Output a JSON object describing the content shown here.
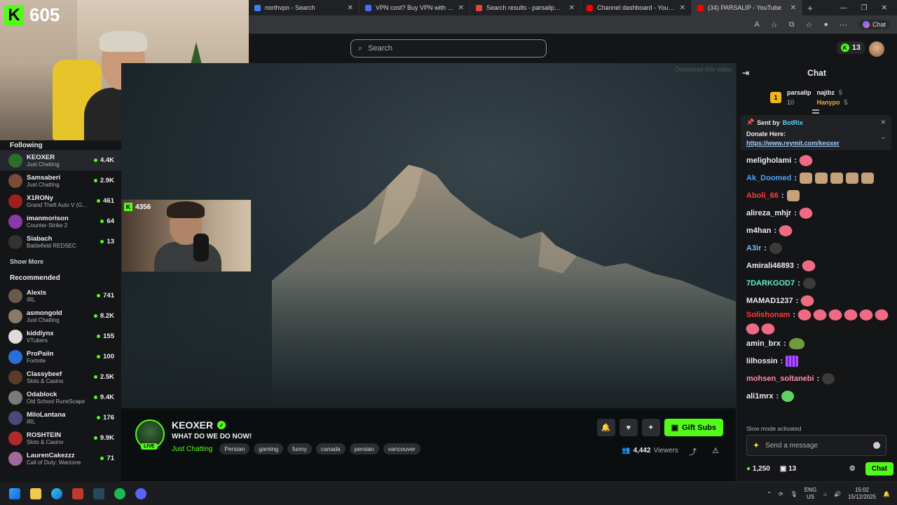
{
  "browser": {
    "tabs": [
      {
        "label": "northvpn - Search",
        "color": "#3b82f6"
      },
      {
        "label": "VPN cost? Buy VPN with Credit C",
        "color": "#4a6cf7"
      },
      {
        "label": "Search results - parsalip@google",
        "color": "#ea4335"
      },
      {
        "label": "Channel dashboard - YouTube St",
        "color": "#ff0000"
      },
      {
        "label": "(34) PARSALIP - YouTube",
        "color": "#ff0000"
      }
    ],
    "copilot_label": "Chat"
  },
  "webcam": {
    "viewer_count": "605",
    "logo_letter": "K"
  },
  "header": {
    "search_placeholder": "Search",
    "coins": "13",
    "download_hint": "Download this video"
  },
  "sidebar": {
    "following_title": "Following",
    "following": [
      {
        "name": "KEOXER",
        "category": "Just Chatting",
        "viewers": "4.4K",
        "color": "#2f6b2f"
      },
      {
        "name": "Samsaberi",
        "category": "Just Chatting",
        "viewers": "2.9K",
        "color": "#7a4a3a"
      },
      {
        "name": "X1RONy",
        "category": "Grand Theft Auto V (G...",
        "viewers": "461",
        "color": "#a02020"
      },
      {
        "name": "imanmorison",
        "category": "Counter-Strike 2",
        "viewers": "64",
        "color": "#8a3aa8"
      },
      {
        "name": "Siabach",
        "category": "Battlefield REDSEC",
        "viewers": "13",
        "color": "#333333"
      }
    ],
    "show_more": "Show More",
    "recommended_title": "Recommended",
    "recommended": [
      {
        "name": "Alexis",
        "category": "IRL",
        "viewers": "741",
        "color": "#6a5a4a"
      },
      {
        "name": "asmongold",
        "category": "Just Chatting",
        "viewers": "8.2K",
        "color": "#8a7a6a"
      },
      {
        "name": "kiddlynx",
        "category": "VTubers",
        "viewers": "155",
        "color": "#dcdcdc"
      },
      {
        "name": "ProPaiin",
        "category": "Fortnite",
        "viewers": "100",
        "color": "#2a6fd6"
      },
      {
        "name": "Classybeef",
        "category": "Slots & Casino",
        "viewers": "2.5K",
        "color": "#5a3a2a"
      },
      {
        "name": "Odablock",
        "category": "Old School RuneScape",
        "viewers": "9.4K",
        "color": "#7a7a7a"
      },
      {
        "name": "MiloLantana",
        "category": "IRL",
        "viewers": "176",
        "color": "#4a4a7a"
      },
      {
        "name": "ROSHTEIN",
        "category": "Slots & Casino",
        "viewers": "9.9K",
        "color": "#b02a2a"
      },
      {
        "name": "LaurenCakezzz",
        "category": "Call of Duty: Warzone",
        "viewers": "71",
        "color": "#a06a9a"
      }
    ]
  },
  "pip": {
    "viewers": "4356"
  },
  "stream": {
    "name": "KEOXER",
    "live_label": "LIVE",
    "title": "WHAT DO WE DO NOW!",
    "category": "Just Chatting",
    "tags": [
      "Persian",
      "gaming",
      "funny",
      "canada",
      "persian",
      "vancouver"
    ],
    "gift_label": "Gift Subs",
    "viewers": "4,442",
    "viewers_label": "Viewers"
  },
  "chat": {
    "title": "Chat",
    "leaders": [
      {
        "name": "parsalip",
        "count": "10"
      },
      {
        "name": "najibz",
        "count": "5"
      },
      {
        "name": "Hanypo",
        "count": "5"
      }
    ],
    "pinned": {
      "sent_by_label": "Sent by",
      "sender": "BotRix",
      "text": "Donate Here:",
      "link": "https://www.reymit.com/keoxer"
    },
    "messages": [
      {
        "user": "meligholami",
        "color": "#efeff1",
        "emotes": [
          "pink"
        ]
      },
      {
        "user": "Ak_Doomed",
        "color": "#4aa3ff",
        "emotes": [
          "face",
          "face",
          "face",
          "face",
          "face"
        ]
      },
      {
        "user": "Aboli_66",
        "color": "#ff3b3b",
        "emotes": [
          "face"
        ]
      },
      {
        "user": "alireza_mhjr",
        "color": "#efeff1",
        "emotes": [
          "pink"
        ]
      },
      {
        "user": "m4han",
        "color": "#efeff1",
        "emotes": [
          "pink"
        ]
      },
      {
        "user": "A3ir",
        "color": "#7ab8ff",
        "emotes": [
          "dark"
        ]
      },
      {
        "user": "Amirali46893",
        "color": "#efeff1",
        "emotes": [
          "pink"
        ]
      },
      {
        "user": "7DARKGOD7",
        "color": "#5ff0d0",
        "emotes": [
          "dark"
        ]
      },
      {
        "user": "MAMAD1237",
        "color": "#efeff1",
        "emotes": [
          "pink"
        ]
      },
      {
        "user": "Solishonam",
        "color": "#ff3b3b",
        "emotes": [
          "pink",
          "pink",
          "pink",
          "pink",
          "pink",
          "pink",
          "pink",
          "pink"
        ]
      },
      {
        "user": "amin_brx",
        "color": "#efeff1",
        "emotes": [
          "frog"
        ]
      },
      {
        "user": "lilhossin",
        "color": "#efeff1",
        "emotes": [
          "grid"
        ]
      },
      {
        "user": "mohsen_soltanebi",
        "color": "#ff8ab0",
        "emotes": [
          "dark"
        ]
      },
      {
        "user": "ali1mrx",
        "color": "#efeff1",
        "emotes": [
          "blob"
        ]
      }
    ],
    "slow_mode": "Slow mode activated",
    "input_placeholder": "Send a message",
    "points": "1,250",
    "subs": "13",
    "send_label": "Chat"
  },
  "taskbar": {
    "lang_top": "ENG",
    "lang_bottom": "US",
    "time": "15:02",
    "date": "15/12/2025"
  }
}
